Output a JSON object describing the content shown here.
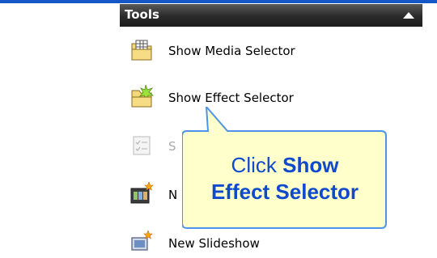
{
  "panel": {
    "title": "Tools",
    "items": [
      {
        "label": "Show Media Selector",
        "icon": "media-folder-icon",
        "state": "enabled"
      },
      {
        "label": "Show Effect Selector",
        "icon": "effect-folder-icon",
        "state": "enabled"
      },
      {
        "label": "S",
        "icon": "checklist-icon",
        "state": "disabled"
      },
      {
        "label": "N",
        "icon": "filmstrip-star-icon",
        "state": "enabled"
      },
      {
        "label": "New Slideshow",
        "icon": "slideshow-star-icon",
        "state": "enabled"
      }
    ]
  },
  "callout": {
    "line1_prefix": "Click ",
    "line1_bold": "Show",
    "line2_bold": "Effect Selector"
  },
  "colors": {
    "header_bg": "#2a2a2a",
    "callout_fill": "#ffffcc",
    "callout_border": "#4d95e8",
    "callout_text": "#0f49cc",
    "top_strip": "#1556c9"
  }
}
